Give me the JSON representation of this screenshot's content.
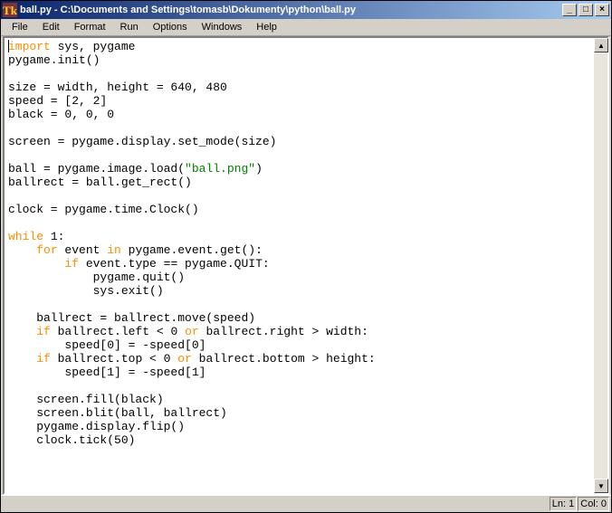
{
  "window": {
    "title_prefix": "ball.py - ",
    "title_path": "C:\\Documents and Settings\\tomasb\\Dokumenty\\python\\ball.py",
    "icon_glyph": "Tk"
  },
  "title_buttons": {
    "minimize": "_",
    "maximize": "□",
    "close": "×"
  },
  "menu": {
    "items": [
      "File",
      "Edit",
      "Format",
      "Run",
      "Options",
      "Windows",
      "Help"
    ]
  },
  "scrollbar": {
    "up": "▲",
    "down": "▼"
  },
  "statusbar": {
    "line_label": "Ln: 1",
    "col_label": "Col: 0"
  },
  "editor": {
    "lines": [
      [
        {
          "t": "import",
          "c": "kw"
        },
        {
          "t": " sys, pygame"
        }
      ],
      [
        {
          "t": "pygame.init()"
        }
      ],
      [],
      [
        {
          "t": "size = width, height = 640, 480"
        }
      ],
      [
        {
          "t": "speed = [2, 2]"
        }
      ],
      [
        {
          "t": "black = 0, 0, 0"
        }
      ],
      [],
      [
        {
          "t": "screen = pygame.display.set_mode(size)"
        }
      ],
      [],
      [
        {
          "t": "ball = pygame.image.load("
        },
        {
          "t": "\"ball.png\"",
          "c": "str"
        },
        {
          "t": ")"
        }
      ],
      [
        {
          "t": "ballrect = ball.get_rect()"
        }
      ],
      [],
      [
        {
          "t": "clock = pygame.time.Clock()"
        }
      ],
      [],
      [
        {
          "t": "while",
          "c": "kw"
        },
        {
          "t": " 1:"
        }
      ],
      [
        {
          "t": "    "
        },
        {
          "t": "for",
          "c": "kw"
        },
        {
          "t": " event "
        },
        {
          "t": "in",
          "c": "kw"
        },
        {
          "t": " pygame.event.get():"
        }
      ],
      [
        {
          "t": "        "
        },
        {
          "t": "if",
          "c": "kw"
        },
        {
          "t": " event.type == pygame.QUIT:"
        }
      ],
      [
        {
          "t": "            pygame.quit()"
        }
      ],
      [
        {
          "t": "            sys.exit()"
        }
      ],
      [],
      [
        {
          "t": "    ballrect = ballrect.move(speed)"
        }
      ],
      [
        {
          "t": "    "
        },
        {
          "t": "if",
          "c": "kw"
        },
        {
          "t": " ballrect.left < 0 "
        },
        {
          "t": "or",
          "c": "kw"
        },
        {
          "t": " ballrect.right > width:"
        }
      ],
      [
        {
          "t": "        speed[0] = -speed[0]"
        }
      ],
      [
        {
          "t": "    "
        },
        {
          "t": "if",
          "c": "kw"
        },
        {
          "t": " ballrect.top < 0 "
        },
        {
          "t": "or",
          "c": "kw"
        },
        {
          "t": " ballrect.bottom > height:"
        }
      ],
      [
        {
          "t": "        speed[1] = -speed[1]"
        }
      ],
      [],
      [
        {
          "t": "    screen.fill(black)"
        }
      ],
      [
        {
          "t": "    screen.blit(ball, ballrect)"
        }
      ],
      [
        {
          "t": "    pygame.display.flip()"
        }
      ],
      [
        {
          "t": "    clock.tick(50)"
        }
      ]
    ]
  }
}
